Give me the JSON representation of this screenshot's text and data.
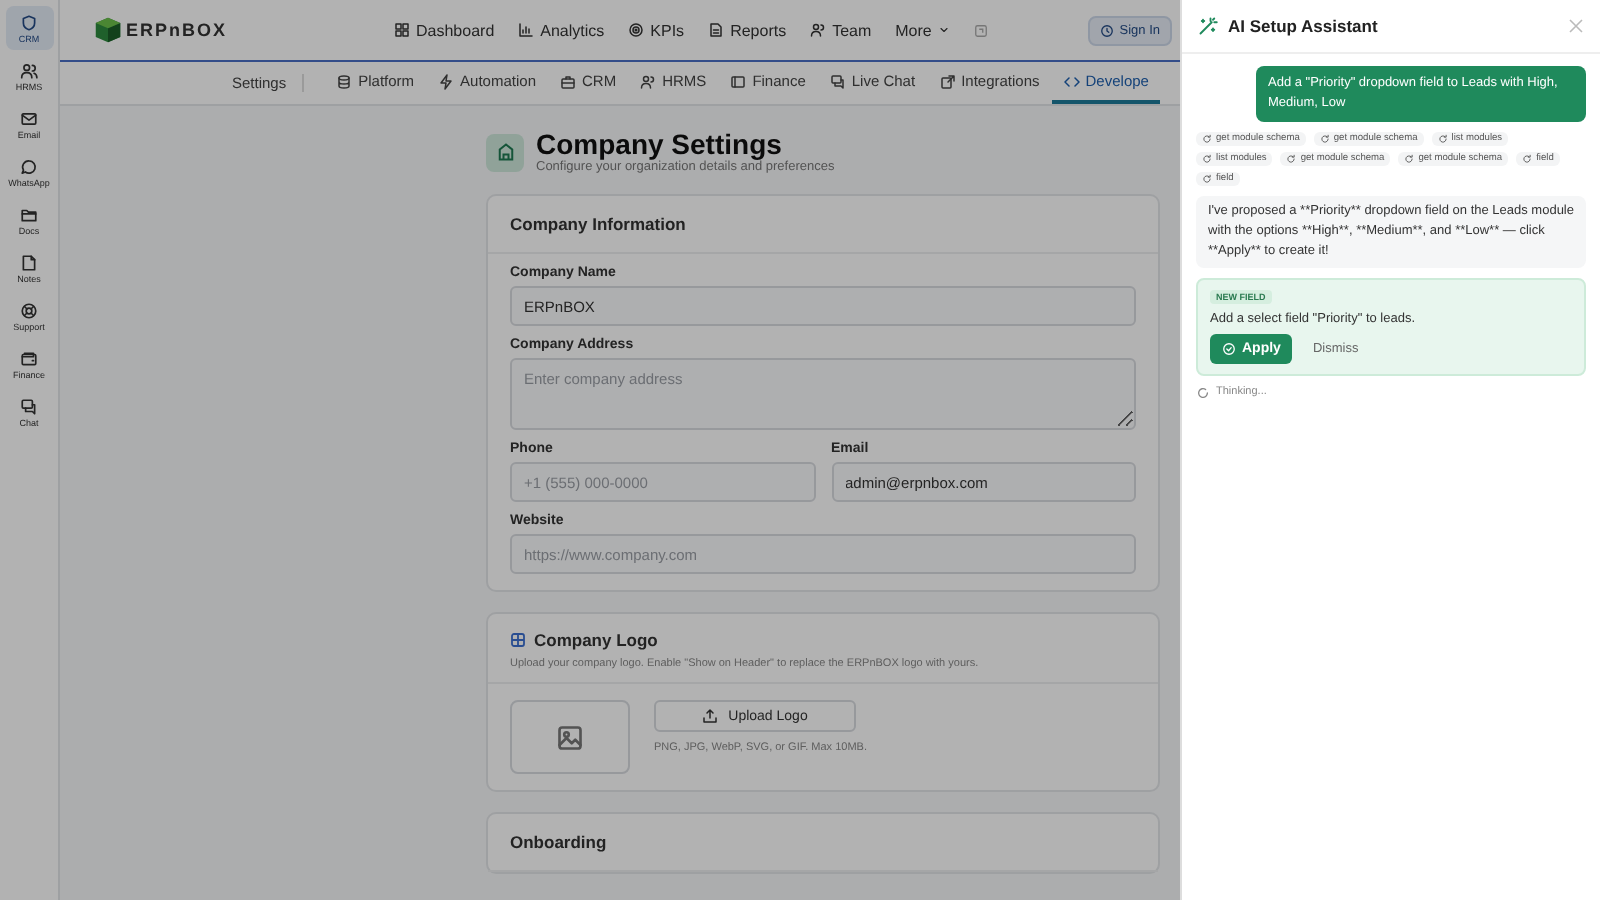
{
  "rail": {
    "items": [
      {
        "label": "CRM",
        "selected": true
      },
      {
        "label": "HRMS",
        "selected": false
      },
      {
        "label": "Email",
        "selected": false
      },
      {
        "label": "WhatsApp",
        "selected": false
      },
      {
        "label": "Docs",
        "selected": false
      },
      {
        "label": "Notes",
        "selected": false
      },
      {
        "label": "Support",
        "selected": false
      },
      {
        "label": "Finance",
        "selected": false
      },
      {
        "label": "Chat",
        "selected": false
      }
    ]
  },
  "header": {
    "logo": "ERPnBOX",
    "nav": [
      "Dashboard",
      "Analytics",
      "KPIs",
      "Reports",
      "Team"
    ],
    "more": "More",
    "sign_in": "Sign In"
  },
  "subnav": {
    "label": "Settings",
    "tabs": [
      {
        "label": "Platform",
        "selected": false
      },
      {
        "label": "Automation",
        "selected": false
      },
      {
        "label": "CRM",
        "selected": false
      },
      {
        "label": "HRMS",
        "selected": false
      },
      {
        "label": "Finance",
        "selected": false
      },
      {
        "label": "Live Chat",
        "selected": false
      },
      {
        "label": "Integrations",
        "selected": false
      },
      {
        "label": "Develope",
        "selected": true
      }
    ]
  },
  "page": {
    "title": "Company Settings",
    "subtitle": "Configure your organization details and preferences"
  },
  "company_information": {
    "title": "Company Information",
    "fields": [
      {
        "kind": "input",
        "label": "Company Name",
        "value": "ERPnBOX"
      },
      {
        "kind": "textarea",
        "label": "Company Address",
        "placeholder": "Enter company address"
      },
      {
        "kind": "input",
        "label": "Phone",
        "placeholder": "+1 (555) 000-0000",
        "half": true
      },
      {
        "kind": "input",
        "label": "Email",
        "value": "admin@erpnbox.com",
        "half": true
      },
      {
        "kind": "input",
        "label": "Website",
        "placeholder": "https://www.company.com"
      }
    ]
  },
  "company_logo": {
    "title": "Company Logo",
    "description": "Upload your company logo. Enable \"Show on Header\" to replace the ERPnBOX logo with yours.",
    "upload_button": "Upload Logo",
    "hint": "PNG, JPG, WebP, SVG, or GIF. Max 10MB."
  },
  "onboarding": {
    "title": "Onboarding"
  },
  "assistant": {
    "title": "AI Setup Assistant",
    "user_message": "Add a \"Priority\" dropdown field to Leads with High, Medium, Low",
    "tool_calls": [
      "get module schema",
      "get module schema",
      "list modules",
      "list modules",
      "get module schema",
      "get module schema",
      "field",
      "field"
    ],
    "reply": "I've proposed a **Priority** dropdown field on the Leads module with the options **High**, **Medium**, and **Low** — click **Apply** to create it!",
    "proposal": {
      "badge": "NEW FIELD",
      "text": "Add a select field \"Priority\" to leads.",
      "apply": "Apply",
      "dismiss": "Dismiss"
    },
    "status": "Thinking..."
  }
}
